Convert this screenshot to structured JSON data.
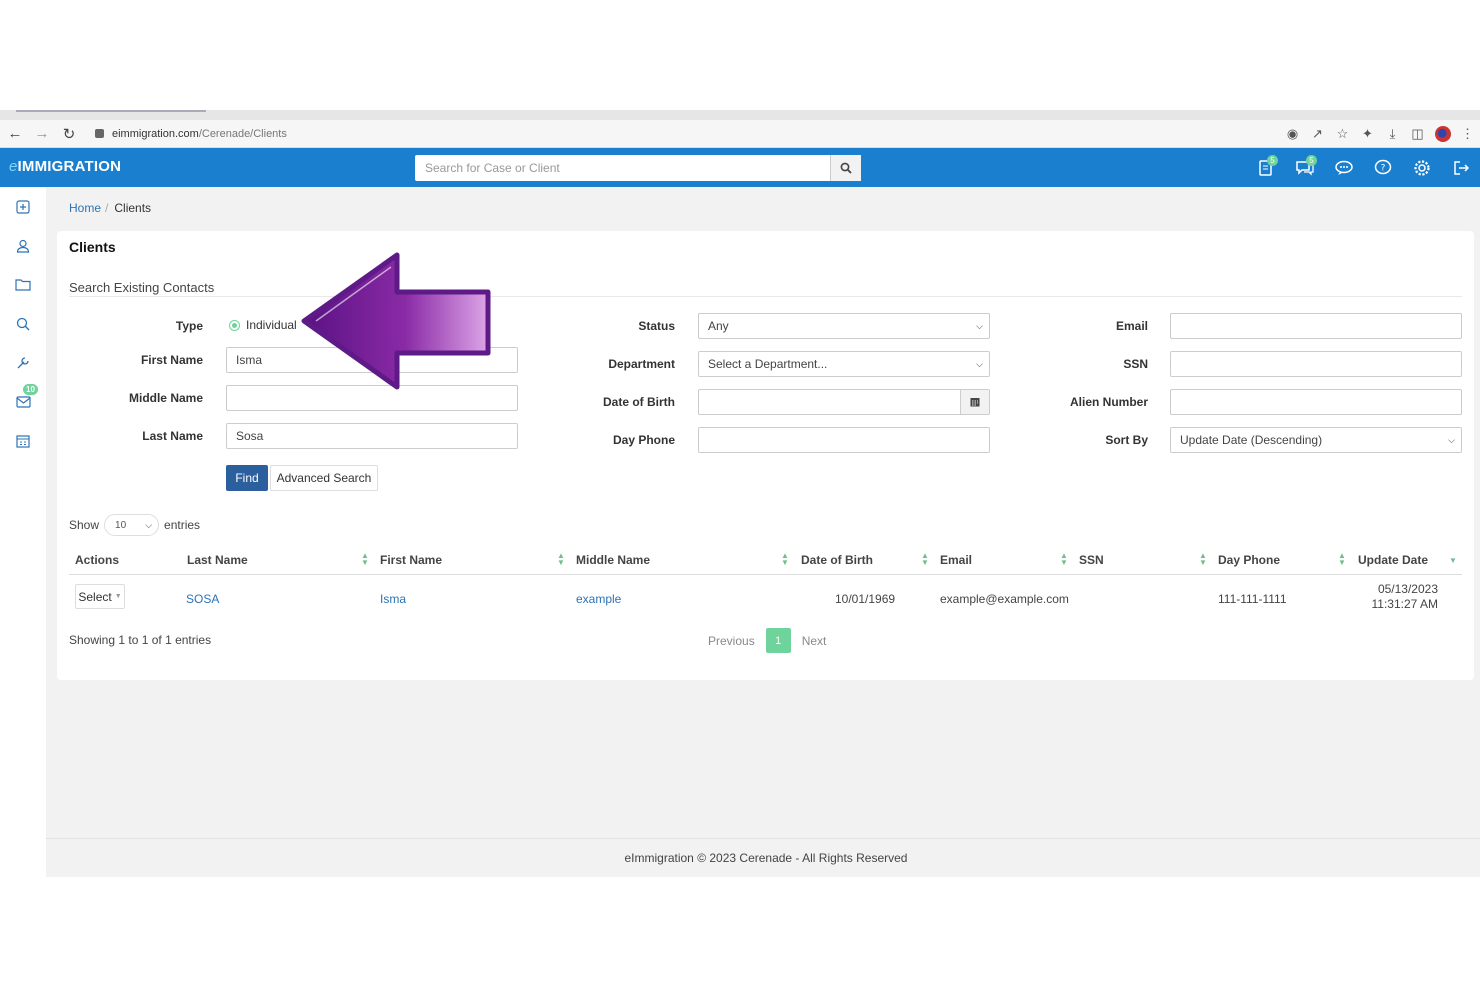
{
  "browser": {
    "url_host": "eimmigration.com",
    "url_path": "/Cerenade/Clients"
  },
  "app": {
    "logo_prefix": "e",
    "logo_text": "IMMIGRATION",
    "search_placeholder": "Search for Case or Client",
    "header_icons": [
      {
        "name": "forms-icon",
        "badge": "5"
      },
      {
        "name": "messages-icon",
        "badge": "5"
      },
      {
        "name": "sms-icon",
        "badge": ""
      },
      {
        "name": "help-icon",
        "badge": ""
      },
      {
        "name": "settings-icon",
        "badge": ""
      },
      {
        "name": "logout-icon",
        "badge": ""
      }
    ]
  },
  "sidebar": {
    "items": [
      {
        "name": "add-icon"
      },
      {
        "name": "user-icon"
      },
      {
        "name": "folder-icon"
      },
      {
        "name": "search-icon"
      },
      {
        "name": "wrench-icon"
      },
      {
        "name": "inbox-icon",
        "badge": "10"
      },
      {
        "name": "calendar-icon"
      }
    ]
  },
  "breadcrumb": {
    "home": "Home",
    "sep": "/",
    "current": "Clients"
  },
  "page": {
    "title": "Clients",
    "section": "Search Existing Contacts"
  },
  "form": {
    "type_label": "Type",
    "type_value": "Individual",
    "first_name_label": "First Name",
    "first_name_value": "Isma",
    "middle_name_label": "Middle Name",
    "middle_name_value": "",
    "last_name_label": "Last Name",
    "last_name_value": "Sosa",
    "status_label": "Status",
    "status_value": "Any",
    "department_label": "Department",
    "department_value": "Select a Department...",
    "dob_label": "Date of Birth",
    "dob_value": "",
    "day_phone_label": "Day Phone",
    "day_phone_value": "",
    "email_label": "Email",
    "email_value": "",
    "ssn_label": "SSN",
    "ssn_value": "",
    "alien_label": "Alien Number",
    "alien_value": "",
    "sort_label": "Sort By",
    "sort_value": "Update Date (Descending)",
    "find_button": "Find",
    "advanced_button": "Advanced Search"
  },
  "table": {
    "show_label": "Show",
    "entries_value": "10",
    "entries_label": "entries",
    "headers": [
      "Actions",
      "Last Name",
      "First Name",
      "Middle Name",
      "Date of Birth",
      "Email",
      "SSN",
      "Day Phone",
      "Update Date"
    ],
    "rows": [
      {
        "action": "Select",
        "last_name": "SOSA",
        "first_name": "Isma",
        "middle_name": "example",
        "dob": "10/01/1969",
        "email": "example@example.com",
        "ssn": "",
        "day_phone": "111-111-1111",
        "update_date": "05/13/2023",
        "update_time": "11:31:27 AM"
      }
    ],
    "info": "Showing 1 to 1 of 1 entries",
    "prev": "Previous",
    "current_page": "1",
    "next": "Next"
  },
  "footer": {
    "text": "eImmigration © 2023 Cerenade - All Rights Reserved"
  },
  "annotation": {
    "arrow_color": "#6a1b9a"
  }
}
